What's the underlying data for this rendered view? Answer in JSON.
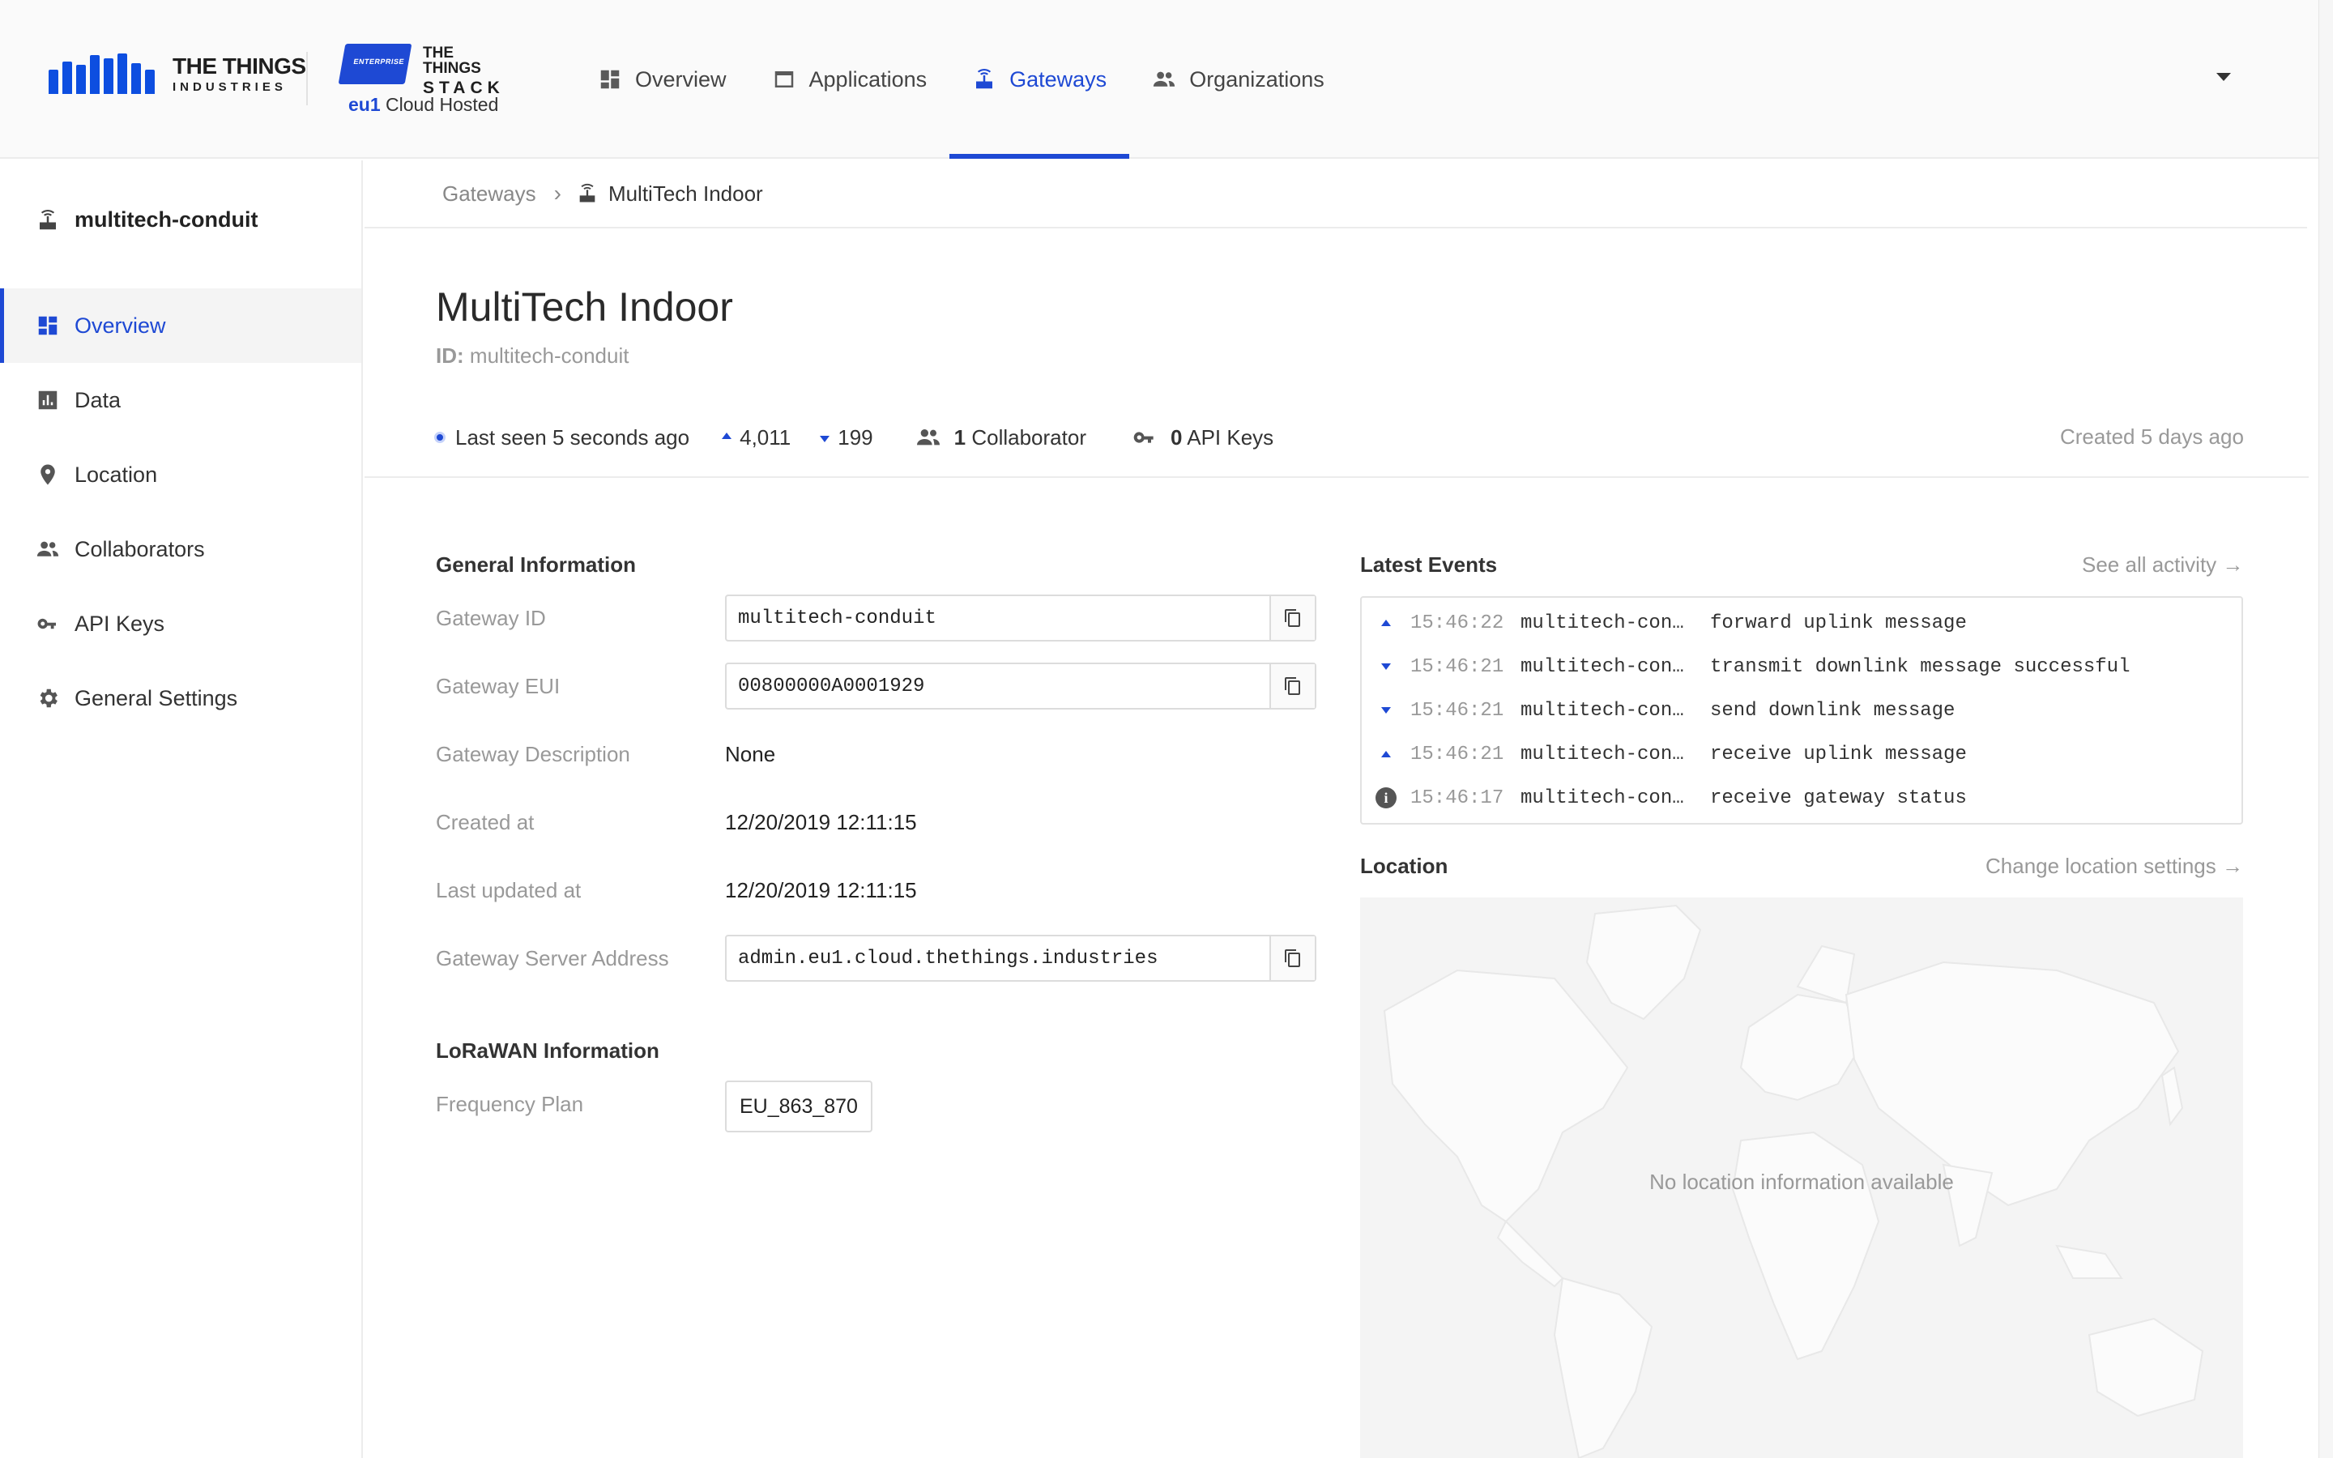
{
  "brand": {
    "tti_line1": "THE THINGS",
    "tti_line2": "INDUSTRIES",
    "stack_badge": "ENTERPRISE",
    "stack_line1": "THE THINGS",
    "stack_line2": "STACK",
    "cluster": "eu1",
    "hosting": "Cloud Hosted",
    "accent_color": "#1e49d4"
  },
  "nav": {
    "items": [
      {
        "label": "Overview",
        "icon": "dashboard-icon"
      },
      {
        "label": "Applications",
        "icon": "window-icon"
      },
      {
        "label": "Gateways",
        "icon": "router-icon",
        "active": true
      },
      {
        "label": "Organizations",
        "icon": "people-icon"
      }
    ]
  },
  "sidebar": {
    "title": "multitech-conduit",
    "items": [
      {
        "label": "Overview",
        "icon": "dashboard-icon",
        "active": true
      },
      {
        "label": "Data",
        "icon": "bar-chart-icon"
      },
      {
        "label": "Location",
        "icon": "map-pin-icon"
      },
      {
        "label": "Collaborators",
        "icon": "people-icon"
      },
      {
        "label": "API Keys",
        "icon": "key-icon"
      },
      {
        "label": "General Settings",
        "icon": "gear-icon"
      }
    ]
  },
  "breadcrumb": {
    "parent": "Gateways",
    "separator": "›",
    "current": "MultiTech Indoor"
  },
  "gateway": {
    "name": "MultiTech Indoor",
    "id_label": "ID:",
    "id": "multitech-conduit",
    "last_seen": "Last seen 5 seconds ago",
    "uplink_count": "4,011",
    "downlink_count": "199",
    "collaborators_count": "1",
    "collaborators_label": "Collaborator",
    "api_keys_count": "0",
    "api_keys_label": "API Keys",
    "created": "Created 5 days ago"
  },
  "general_info": {
    "title": "General Information",
    "gateway_id_label": "Gateway ID",
    "gateway_id": "multitech-conduit",
    "gateway_eui_label": "Gateway EUI",
    "gateway_eui": "00800000A0001929",
    "description_label": "Gateway Description",
    "description": "None",
    "created_at_label": "Created at",
    "created_at": "12/20/2019 12:11:15",
    "updated_at_label": "Last updated at",
    "updated_at": "12/20/2019 12:11:15",
    "server_address_label": "Gateway Server Address",
    "server_address": "admin.eu1.cloud.thethings.industries"
  },
  "lorawan_info": {
    "title": "LoRaWAN Information",
    "frequency_plan_label": "Frequency Plan",
    "frequency_plan": "EU_863_870"
  },
  "events": {
    "title": "Latest Events",
    "see_all": "See all activity →",
    "rows": [
      {
        "type": "uplink",
        "time": "15:46:22",
        "id": "multitech-con…",
        "message": "forward uplink message"
      },
      {
        "type": "downlink",
        "time": "15:46:21",
        "id": "multitech-con…",
        "message": "transmit downlink message successful"
      },
      {
        "type": "downlink",
        "time": "15:46:21",
        "id": "multitech-con…",
        "message": "send downlink message"
      },
      {
        "type": "uplink",
        "time": "15:46:21",
        "id": "multitech-con…",
        "message": "receive uplink message"
      },
      {
        "type": "info",
        "time": "15:46:17",
        "id": "multitech-con…",
        "message": "receive gateway status"
      }
    ],
    "info_glyph": "i"
  },
  "location": {
    "title": "Location",
    "change_link": "Change location settings →",
    "empty_message": "No location information available"
  }
}
